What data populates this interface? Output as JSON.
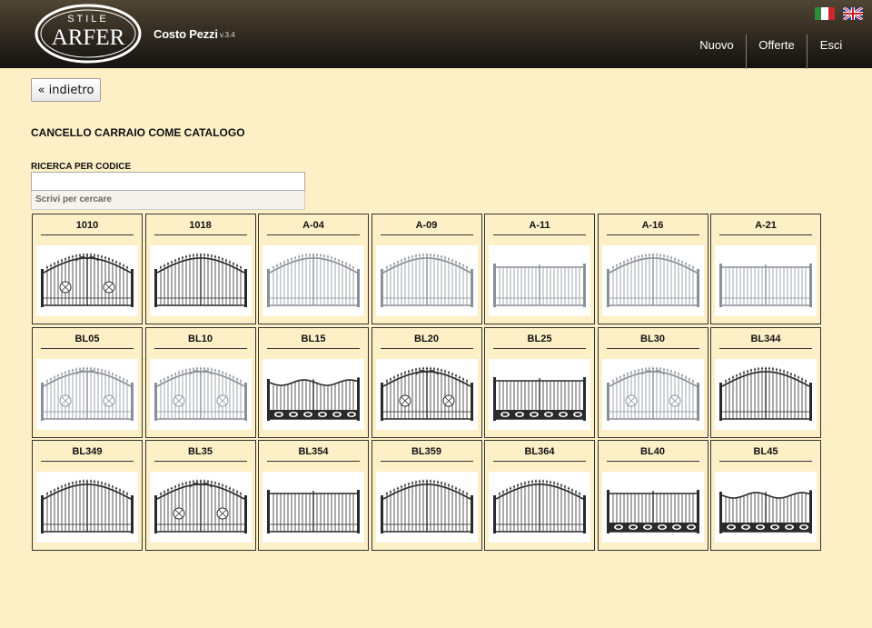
{
  "header": {
    "logo_top": "STILE",
    "logo_main": "ARFER",
    "app_title": "Costo Pezzi",
    "version": "v.3.4",
    "flags": [
      "flag-it-icon",
      "flag-uk-icon"
    ],
    "nav": [
      "Nuovo",
      "Offerte",
      "Esci"
    ]
  },
  "back_label": "« indietro",
  "page_title": "CANCELLO CARRAIO COME CATALOGO",
  "search": {
    "label": "RICERCA PER CODICE",
    "value": "",
    "hint": "Scrivi per cercare"
  },
  "products": [
    {
      "code": "1010",
      "style": "arch-ornate",
      "color": "dark"
    },
    {
      "code": "1018",
      "style": "arch",
      "color": "dark"
    },
    {
      "code": "A-04",
      "style": "arch-spear",
      "color": "light"
    },
    {
      "code": "A-09",
      "style": "arch-spear",
      "color": "light"
    },
    {
      "code": "A-11",
      "style": "flat",
      "color": "light"
    },
    {
      "code": "A-16",
      "style": "arch-spear",
      "color": "light"
    },
    {
      "code": "A-21",
      "style": "flat",
      "color": "light"
    },
    {
      "code": "BL05",
      "style": "scroll-rings",
      "color": "light"
    },
    {
      "code": "BL10",
      "style": "scroll-rings",
      "color": "light"
    },
    {
      "code": "BL15",
      "style": "wave-panel",
      "color": "dark"
    },
    {
      "code": "BL20",
      "style": "scroll-rings",
      "color": "dark"
    },
    {
      "code": "BL25",
      "style": "flat-panel",
      "color": "dark"
    },
    {
      "code": "BL30",
      "style": "arch-rings",
      "color": "light"
    },
    {
      "code": "BL344",
      "style": "arch-spear",
      "color": "dark"
    },
    {
      "code": "BL349",
      "style": "arch-spear",
      "color": "dark"
    },
    {
      "code": "BL35",
      "style": "scroll-rings",
      "color": "dark"
    },
    {
      "code": "BL354",
      "style": "flat",
      "color": "dark"
    },
    {
      "code": "BL359",
      "style": "arch-spear",
      "color": "dark"
    },
    {
      "code": "BL364",
      "style": "arch-spear",
      "color": "dark"
    },
    {
      "code": "BL40",
      "style": "flat-panel",
      "color": "dark"
    },
    {
      "code": "BL45",
      "style": "wave-panel",
      "color": "dark"
    }
  ]
}
